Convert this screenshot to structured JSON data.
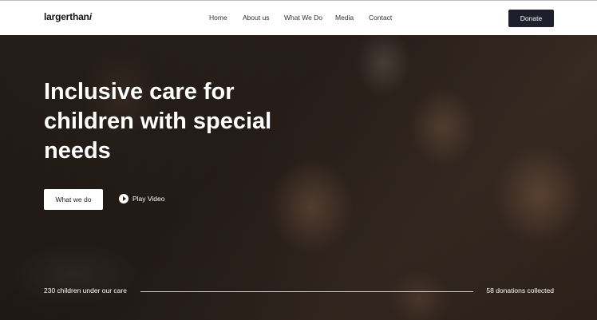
{
  "nav": {
    "logo_text": "largerthan",
    "logo_accent": "i",
    "links": [
      "Home",
      "About us",
      "What We Do",
      "Media",
      "Contact"
    ],
    "donate_label": "Donate"
  },
  "hero": {
    "headline": "Inclusive care for children with special needs",
    "primary_button": "What we do",
    "play_label": "Play Video"
  },
  "stats": {
    "left": "230 children under our care",
    "right": "58 donations collected"
  },
  "colors": {
    "donate_bg": "#1d1f2b",
    "hero_text": "#ffffff"
  },
  "icons": {
    "play": "play-icon"
  }
}
